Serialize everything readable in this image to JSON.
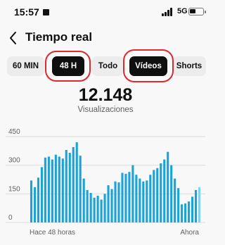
{
  "status": {
    "time": "15:57",
    "network": "5G"
  },
  "header": {
    "title": "Tiempo real"
  },
  "filters": [
    {
      "label": "60 MIN",
      "selected": false
    },
    {
      "label": "48 H",
      "selected": true
    },
    {
      "label": "Todo",
      "selected": false
    },
    {
      "label": "Vídeos",
      "selected": true
    },
    {
      "label": "Shorts",
      "selected": false
    }
  ],
  "metric": {
    "value": "12.148",
    "label": "Visualizaciones"
  },
  "colors": {
    "bar": "#1aa3d6",
    "bar_latest": "#7fd3ee",
    "annotation": "#e0282f"
  },
  "chart_data": {
    "type": "bar",
    "x_start_label": "Hace 48 horas",
    "x_end_label": "Ahora",
    "ylim": [
      0,
      450
    ],
    "yticks": [
      0,
      150,
      300,
      450
    ],
    "grid": true,
    "values": [
      220,
      185,
      235,
      290,
      340,
      345,
      330,
      355,
      345,
      335,
      380,
      365,
      395,
      420,
      350,
      230,
      170,
      155,
      130,
      140,
      120,
      150,
      195,
      175,
      215,
      210,
      260,
      255,
      265,
      300,
      250,
      230,
      215,
      220,
      250,
      275,
      285,
      310,
      330,
      370,
      300,
      230,
      180,
      95,
      100,
      110,
      135,
      170,
      185
    ]
  }
}
